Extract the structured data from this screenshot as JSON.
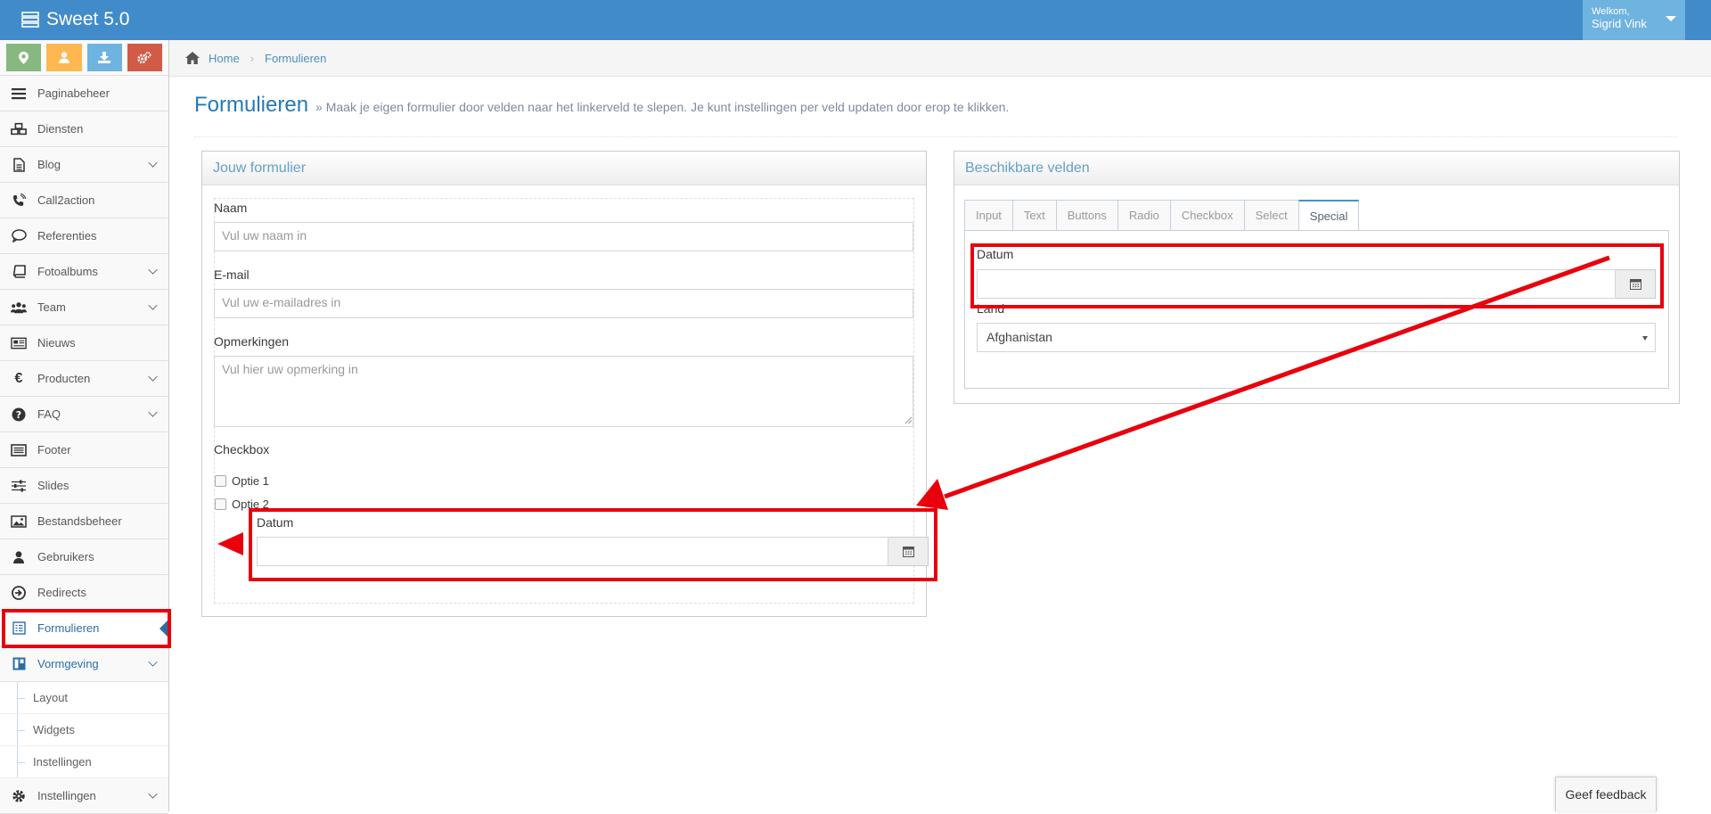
{
  "app": {
    "title": "Sweet 5.0"
  },
  "user": {
    "greeting": "Welkom,",
    "name": "Sigrid Vink"
  },
  "colors": {
    "topbar": "#428bca",
    "accent": "#2b6ea6",
    "highlight": "#e8000c",
    "shortcut_green": "#87b87f",
    "shortcut_orange": "#ffb752",
    "shortcut_blue": "#6fb3e0",
    "shortcut_red": "#d15b47"
  },
  "shortcuts": [
    {
      "icon": "map-marker-icon"
    },
    {
      "icon": "user-icon"
    },
    {
      "icon": "download-icon"
    },
    {
      "icon": "cogs-icon"
    }
  ],
  "sidebar": {
    "items": [
      {
        "label": "Paginabeheer",
        "icon": "bars-icon"
      },
      {
        "label": "Diensten",
        "icon": "cubes-icon"
      },
      {
        "label": "Blog",
        "icon": "file-text-icon"
      },
      {
        "label": "Call2action",
        "icon": "phone-volume-icon"
      },
      {
        "label": "Referenties",
        "icon": "comment-icon"
      },
      {
        "label": "Fotoalbums",
        "icon": "book-icon"
      },
      {
        "label": "Team",
        "icon": "users-icon"
      },
      {
        "label": "Nieuws",
        "icon": "newspaper-icon"
      },
      {
        "label": "Producten",
        "icon": "euro-icon"
      },
      {
        "label": "FAQ",
        "icon": "question-circle-icon"
      },
      {
        "label": "Footer",
        "icon": "list-alt-icon"
      },
      {
        "label": "Slides",
        "icon": "sliders-icon"
      },
      {
        "label": "Bestandsbeheer",
        "icon": "image-icon"
      },
      {
        "label": "Gebruikers",
        "icon": "user-icon"
      },
      {
        "label": "Redirects",
        "icon": "arrow-circle-right-icon"
      },
      {
        "label": "Formulieren",
        "icon": "form-icon"
      },
      {
        "label": "Vormgeving",
        "icon": "layout-icon"
      },
      {
        "label": "Instellingen",
        "icon": "cog-icon"
      }
    ],
    "sub_items": [
      {
        "label": "Layout"
      },
      {
        "label": "Widgets"
      },
      {
        "label": "Instellingen"
      }
    ]
  },
  "breadcrumb": {
    "home": "Home",
    "current": "Formulieren"
  },
  "page": {
    "title": "Formulieren",
    "subtitle": "» Maak je eigen formulier door velden naar het linkerveld te slepen. Je kunt instellingen per veld updaten door erop te klikken."
  },
  "form_widget": {
    "title": "Jouw formulier",
    "fields": {
      "naam_label": "Naam",
      "naam_placeholder": "Vul uw naam in",
      "email_label": "E-mail",
      "email_placeholder": "Vul uw e-mailadres in",
      "opmerkingen_label": "Opmerkingen",
      "opmerkingen_placeholder": "Vul hier uw opmerking in",
      "checkbox_label": "Checkbox",
      "optie1": "Optie 1",
      "optie2": "Optie 2",
      "datum_label": "Datum"
    }
  },
  "fields_widget": {
    "title": "Beschikbare velden",
    "tabs": [
      "Input",
      "Text",
      "Buttons",
      "Radio",
      "Checkbox",
      "Select",
      "Special"
    ],
    "active_tab": "Special",
    "datum_label": "Datum",
    "land_label": "Land",
    "land_value": "Afghanistan"
  },
  "feedback": {
    "label": "Geef feedback"
  }
}
